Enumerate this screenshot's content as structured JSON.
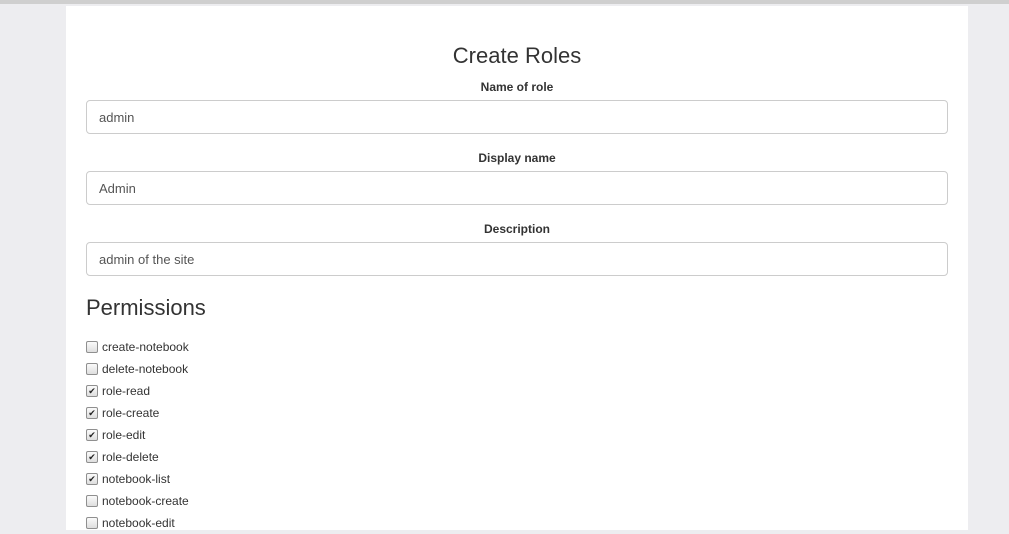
{
  "form": {
    "title": "Create Roles",
    "fields": [
      {
        "label": "Name of role",
        "value": "admin"
      },
      {
        "label": "Display name",
        "value": "Admin"
      },
      {
        "label": "Description",
        "value": "admin of the site"
      }
    ]
  },
  "permissions": {
    "heading": "Permissions",
    "items": [
      {
        "label": "create-notebook",
        "checked": false
      },
      {
        "label": "delete-notebook",
        "checked": false
      },
      {
        "label": "role-read",
        "checked": true
      },
      {
        "label": "role-create",
        "checked": true
      },
      {
        "label": "role-edit",
        "checked": true
      },
      {
        "label": "role-delete",
        "checked": true
      },
      {
        "label": "notebook-list",
        "checked": true
      },
      {
        "label": "notebook-create",
        "checked": false
      },
      {
        "label": "notebook-edit",
        "checked": false
      }
    ]
  }
}
